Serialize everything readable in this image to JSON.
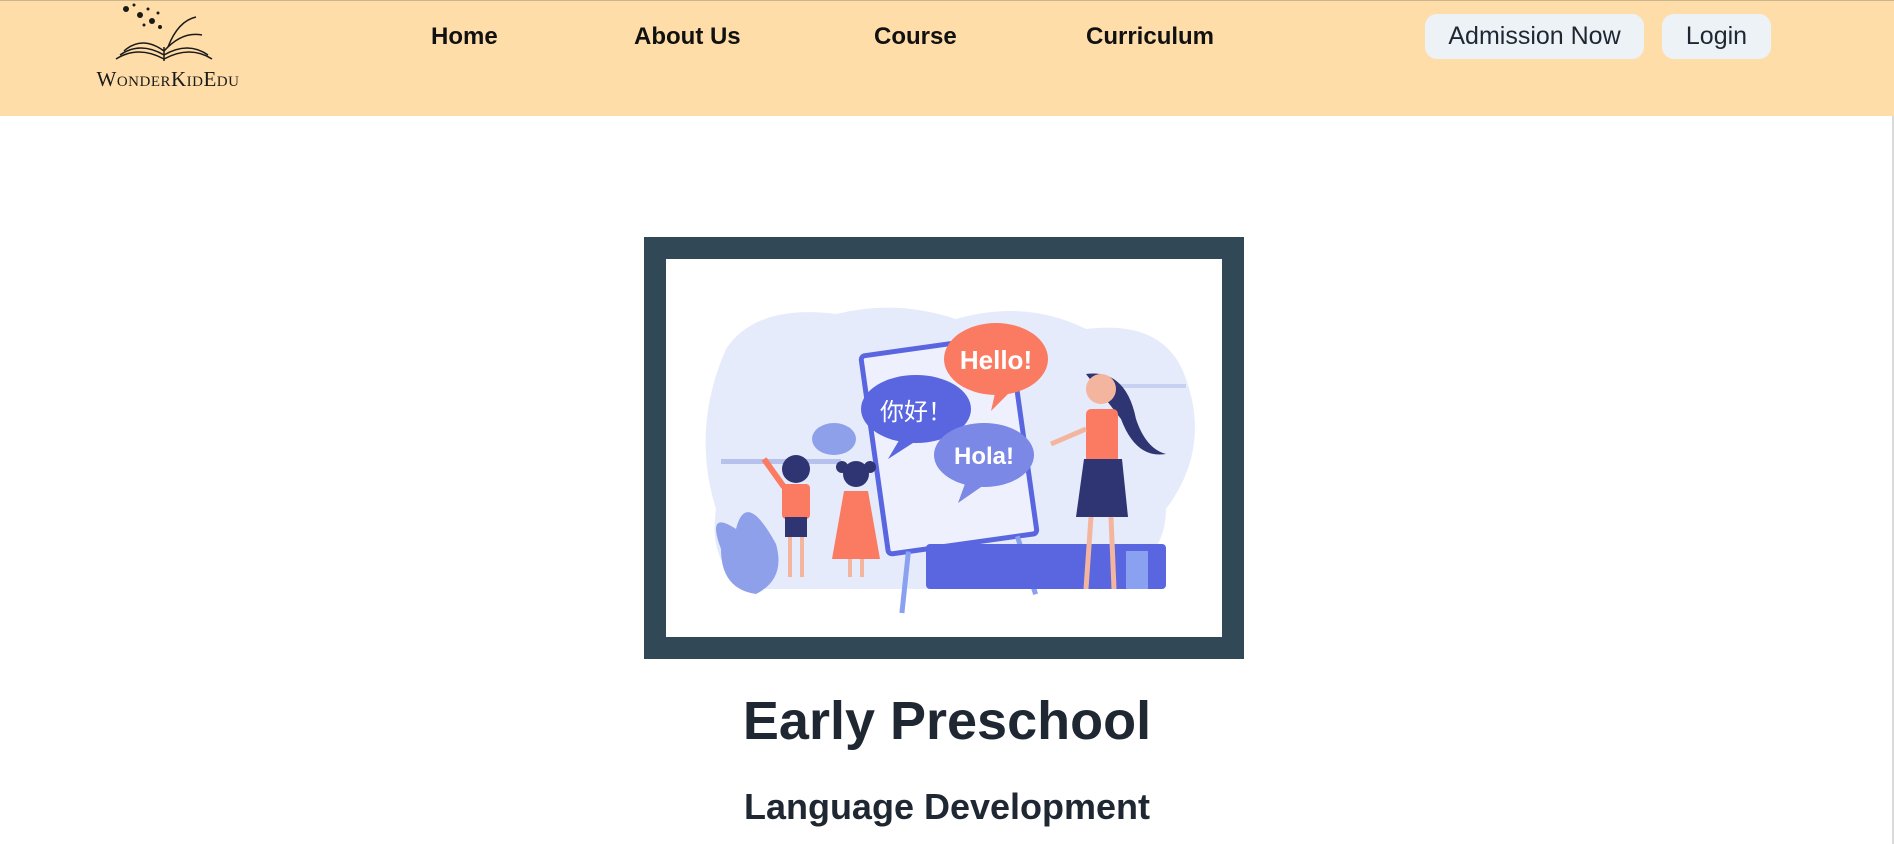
{
  "brand": {
    "name": "WonderKidEdu"
  },
  "nav": {
    "items": [
      "Home",
      "About Us",
      "Course",
      "Curriculum"
    ]
  },
  "actions": {
    "admission": "Admission Now",
    "login": "Login"
  },
  "illustration": {
    "bubbles": [
      "Hello!",
      "你好！",
      "Hola!"
    ],
    "colors": {
      "frame": "#314857",
      "accent": "#fa7b62",
      "blue": "#5966e0"
    }
  },
  "content": {
    "title": "Early Preschool",
    "subtitle": "Language Development"
  },
  "theme": {
    "header_bg": "#fedda8",
    "button_bg": "#edf2f7",
    "text": "#1f2733"
  }
}
